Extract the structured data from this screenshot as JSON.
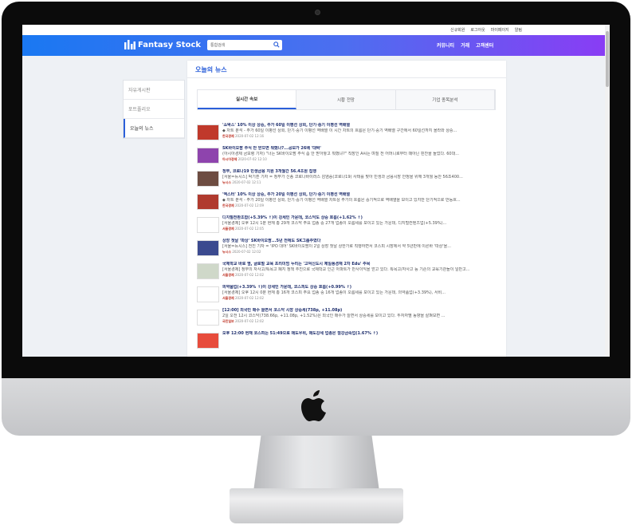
{
  "topbar": {
    "signup": "신규회원",
    "login": "로그아웃",
    "mypage": "마이페이지",
    "notify": "알림"
  },
  "header": {
    "logo": "Fantasy Stock",
    "search_placeholder": "통합검색",
    "nav": [
      "커뮤니티",
      "거래",
      "고객센터"
    ]
  },
  "sidebar": {
    "items": [
      "자유게시판",
      "포트폴리오",
      "오늘의 뉴스"
    ]
  },
  "main": {
    "title": "오늘의 뉴스",
    "tabs": [
      "실시간 속보",
      "시황 전망",
      "기업 종목분석"
    ]
  },
  "news": [
    {
      "headline": "'쇼박스' 10% 이상 상승, 주가 60일 이평선 상회, 단기·중기 이평선 역배열",
      "body": "◆ 차트 분석 - 주가 60일 이평선 상회, 단기·중기 이평선 역배열 이 시간 차트의 흐름은 단기·중기 역배열 구간에서 60일선까지 올라와 상승...",
      "source": "한국경제",
      "date": "2020-07-02 12:16",
      "thumb": "#c0392b"
    },
    {
      "headline": "SK바이오팜 주식 안 받으면 뭐했나?...공모가 26배 '대박'",
      "body": "(아시아경제 금보령 기자) \"너는 SK바이오팜 주식 좀 안 받아놓고 뭐했냐?\" 직장인 A씨는 며칠 전 어머니로부터 때아닌 핀잔을 들었다. 60대...",
      "source": "아시아경제",
      "date": "2020-07-02 12:10",
      "thumb": "#8e44ad"
    },
    {
      "headline": "정부, 코로나19 민생금융 지원 3개월간 56.4조원 집행",
      "body": "[서울=뉴시스] 박기훈 기자 = 정부가 신종 코로나바이러스 감염증(코로나19) 사태를 맞아 민생과 금융시장 안정을 위해 3개월 동안 56조400...",
      "source": "뉴시스",
      "date": "2020-07-02 12:11",
      "thumb": "#6d4c41"
    },
    {
      "headline": "'엑스터' 10% 이상 상승, 주가 20일 이평선 상회, 단기·중기 이평선 역배열",
      "body": "◆ 차트 분석 - 주가 20일 이평선 상회, 단기·중기 이평선 역배열 차트상 주가의 흐름은 중기적으로 역배열을 보이고 있지만 단기적으로 반등흐...",
      "source": "한국경제",
      "date": "2020-07-02 12:09",
      "thumb": "#b03a2e"
    },
    {
      "headline": "디지털전환조합(+5.39% ↑)이 강세인 가운데, 코스닥도 상승 흐름(+1.62% ↑)",
      "body": "[서울경제] 오후 12시 1분 현재 총 29개 코스닥 주요 업종 중 27개 업종이 오름세를 보이고 있는 가운데, 디지털컨텐츠업(+5.39%)...",
      "source": "서울경제",
      "date": "2020-07-02 12:05",
      "thumb": "#ffffff"
    },
    {
      "headline": "상장 첫날 '따상' SK바이오팜...5년 전에도 SK그룹주였다",
      "body": "[서울=뉴시스] 전진 기자 = 'IPO 대어' SK바이오팜이 2일 상장 첫날 상한가로 직행하면서 코스피 시장에서 약 5년만에 이른바 '따상'을...",
      "source": "뉴시스",
      "date": "2020-07-02 12:02",
      "thumb": "#3b4a8f"
    },
    {
      "headline": "국제학교 바로 옆, 글로벌 교육 프리미엄 누리는 '고덕신도시 제일풍경채 2차 Edu' 주목",
      "body": "[서울경제] 정부의 자사고/특목고 폐지 정책 추진으로 국제학교 인근 아파트가 반사이익을 얻고 있다. 특목고/자사고 등 기존의 교육기관들이 일반고...",
      "source": "서울경제",
      "date": "2020-07-02 12:02",
      "thumb": "#cfd8c9"
    },
    {
      "headline": "의약품업(+3.39% ↑)이 강세인 가운데, 코스피도 상승 흐름(+0.99% ↑)",
      "body": "[서울경제] 오후 12시 0분 현재 총 16개 코스피 주요 업종 중 16개 업종이 오름세를 보이고 있는 가운데, 의약품업(+3.39%), 서비...",
      "source": "서울경제",
      "date": "2020-07-02 12:02",
      "thumb": "#ffffff"
    },
    {
      "headline": "[12:00] 외국인 매수 늘면서 코스닥 시장 상승세(738p, +11.08p)",
      "body": "2일 오전 12시 코스닥(738.66p, +11.08p, +1.52%)은 외국인 매수가 늘면서 상승세를 보이고 있다. 투자자별 동향을 살펴보면 ...",
      "source": "국민일보",
      "date": "2020-07-02 12:02",
      "thumb": "#ffffff"
    },
    {
      "headline": "오후 12:00 현재 코스피는 51:49으로 매도우위, 매도강세 업종은 철강금속업(1.67% ↑)",
      "body": "",
      "source": "",
      "date": "",
      "thumb": "#e74c3c"
    }
  ]
}
